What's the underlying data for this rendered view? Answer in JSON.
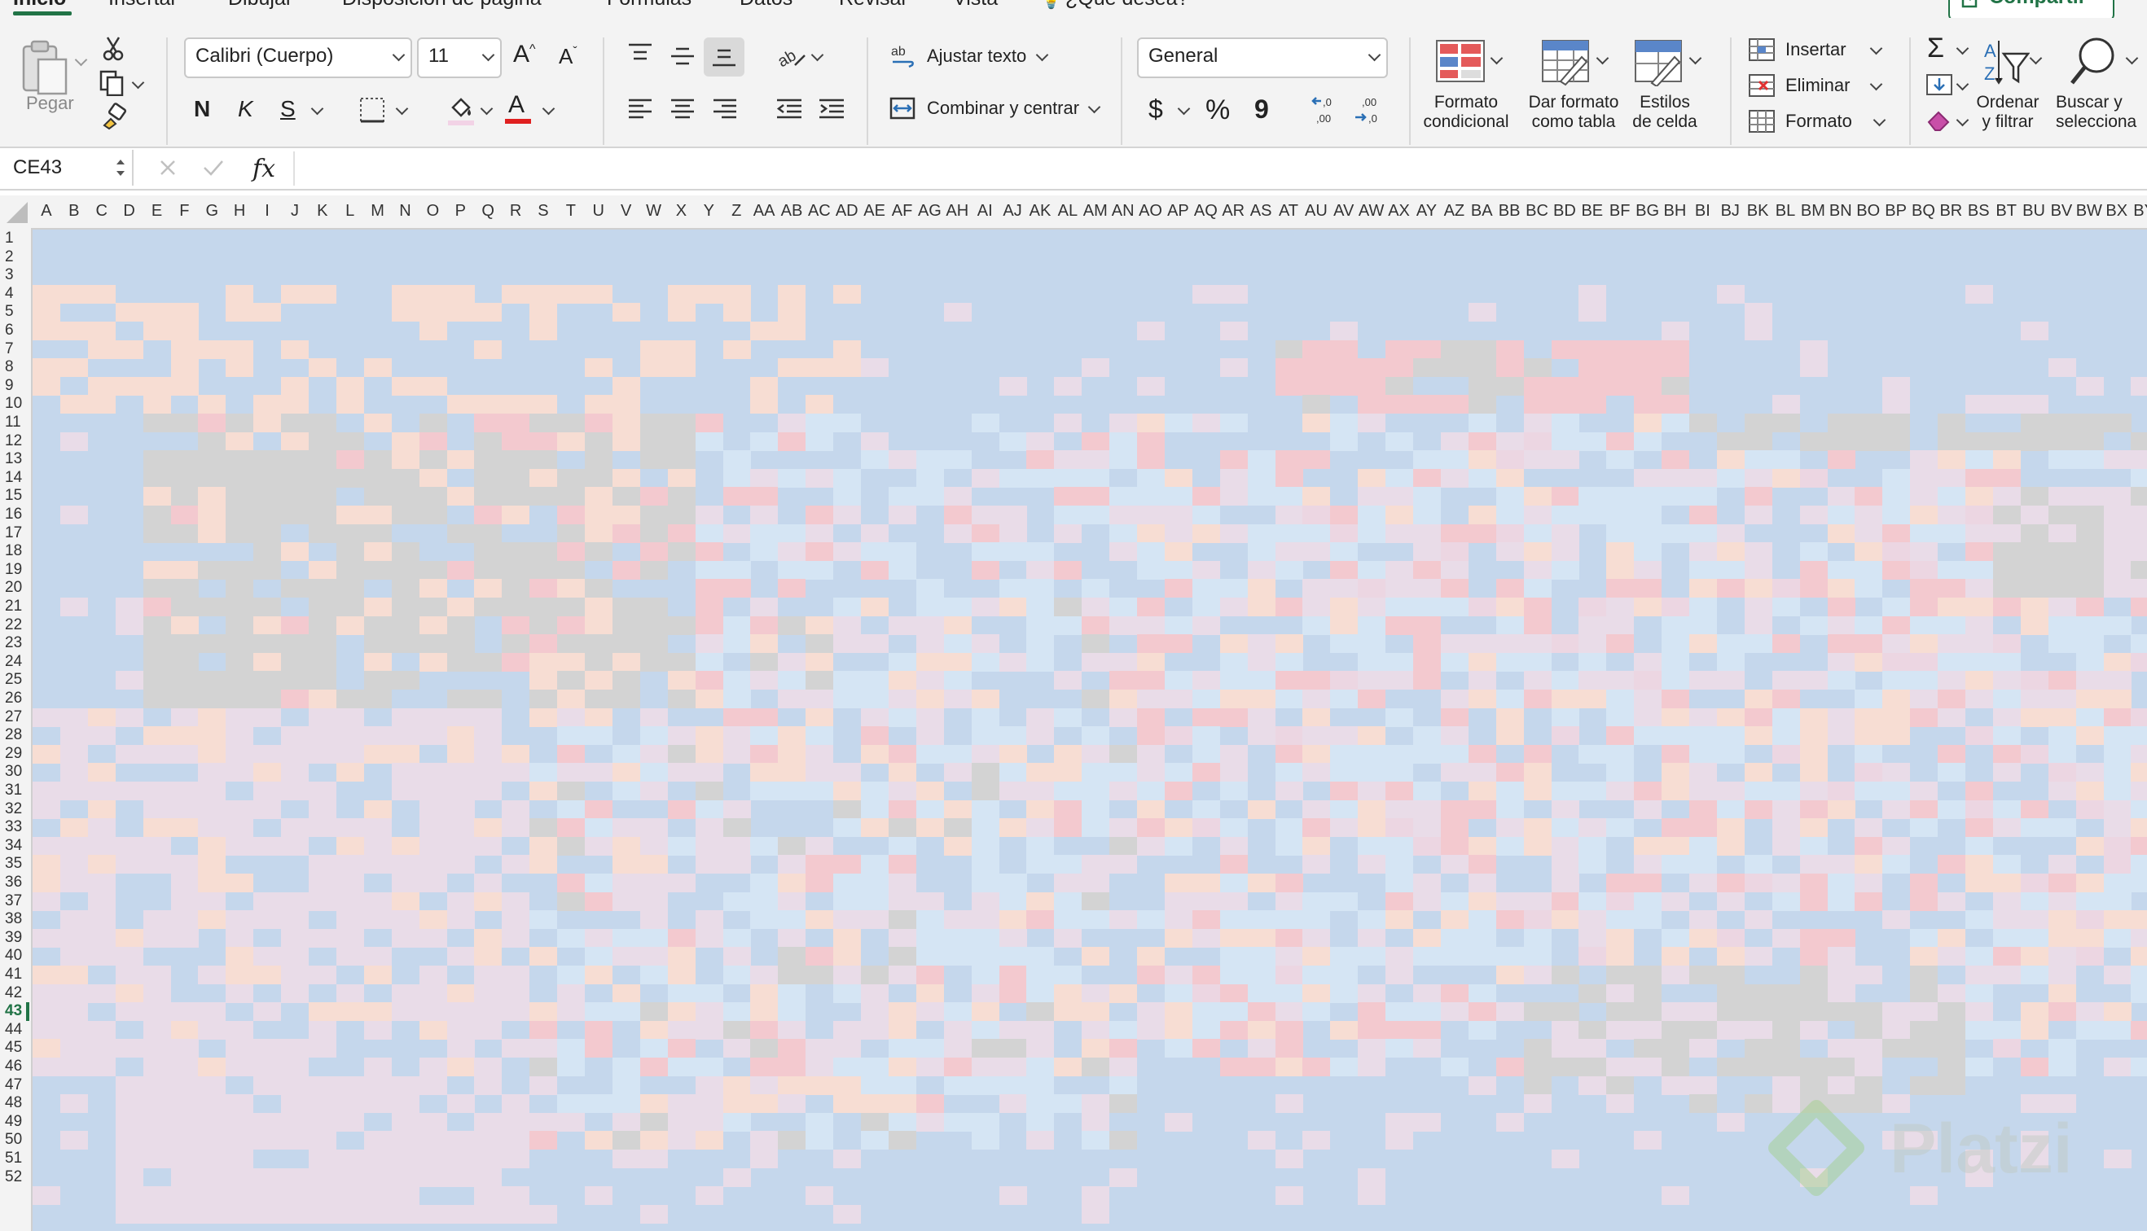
{
  "ribbon_tabs": [
    {
      "label": "Inicio",
      "active": true
    },
    {
      "label": "Insertar"
    },
    {
      "label": "Dibujar"
    },
    {
      "label": "Disposición de página"
    },
    {
      "label": "Fórmulas"
    },
    {
      "label": "Datos"
    },
    {
      "label": "Revisar"
    },
    {
      "label": "Vista"
    },
    {
      "label": "¿Qué desea?"
    }
  ],
  "share_label": "Compartir",
  "clipboard": {
    "paste_label": "Pegar"
  },
  "font": {
    "name": "Calibri (Cuerpo)",
    "size": "11",
    "bold": "N",
    "italic": "K",
    "underline": "S",
    "color_letter": "A"
  },
  "alignment": {
    "wrap_label": "Ajustar texto",
    "merge_label": "Combinar y centrar"
  },
  "number": {
    "format": "General",
    "currency": "$",
    "percent": "%",
    "comma": "9"
  },
  "styles": {
    "conditional": "Formato\ncondicional",
    "as_table": "Dar formato\ncomo tabla",
    "cell_styles": "Estilos\nde celda"
  },
  "cells": {
    "insert": "Insertar",
    "delete": "Eliminar",
    "format": "Formato"
  },
  "editing": {
    "sort": "Ordenar\ny filtrar",
    "find": "Buscar y\nselecciona"
  },
  "formula_bar": {
    "name_box": "CE43",
    "fx": "fx",
    "value": ""
  },
  "columns": [
    "A",
    "B",
    "C",
    "D",
    "E",
    "F",
    "G",
    "H",
    "I",
    "J",
    "K",
    "L",
    "M",
    "N",
    "O",
    "P",
    "Q",
    "R",
    "S",
    "T",
    "U",
    "V",
    "W",
    "X",
    "Y",
    "Z",
    "AA",
    "AB",
    "AC",
    "AD",
    "AE",
    "AF",
    "AG",
    "AH",
    "AI",
    "AJ",
    "AK",
    "AL",
    "AM",
    "AN",
    "AO",
    "AP",
    "AQ",
    "AR",
    "AS",
    "AT",
    "AU",
    "AV",
    "AW",
    "AX",
    "AY",
    "AZ",
    "BA",
    "BB",
    "BC",
    "BD",
    "BE",
    "BF",
    "BG",
    "BH",
    "BI",
    "BJ",
    "BK",
    "BL",
    "BM",
    "BN",
    "BO",
    "BP",
    "BQ",
    "BR",
    "BS",
    "BT",
    "BU",
    "BV",
    "BW",
    "BX",
    "BY"
  ],
  "rows": [
    "1",
    "2",
    "3",
    "4",
    "5",
    "6",
    "7",
    "8",
    "9",
    "10",
    "11",
    "12",
    "13",
    "14",
    "15",
    "16",
    "17",
    "18",
    "19",
    "20",
    "21",
    "22",
    "23",
    "24",
    "25",
    "26",
    "27",
    "28",
    "29",
    "30",
    "31",
    "32",
    "33",
    "34",
    "35",
    "36",
    "37",
    "38",
    "39",
    "40",
    "41",
    "42",
    "43",
    "44",
    "45",
    "46",
    "47",
    "48",
    "49",
    "50",
    "51",
    "52"
  ],
  "selected_row": "43",
  "watermark": "Platzi",
  "colors": {
    "accent": "#217346",
    "sheet_base": "#c5d7ec",
    "palette": [
      "#f7ddd3",
      "#e9dce8",
      "#d5e5f4",
      "#f3c9cf",
      "#d3d3d3",
      "#ecd6e2"
    ]
  }
}
